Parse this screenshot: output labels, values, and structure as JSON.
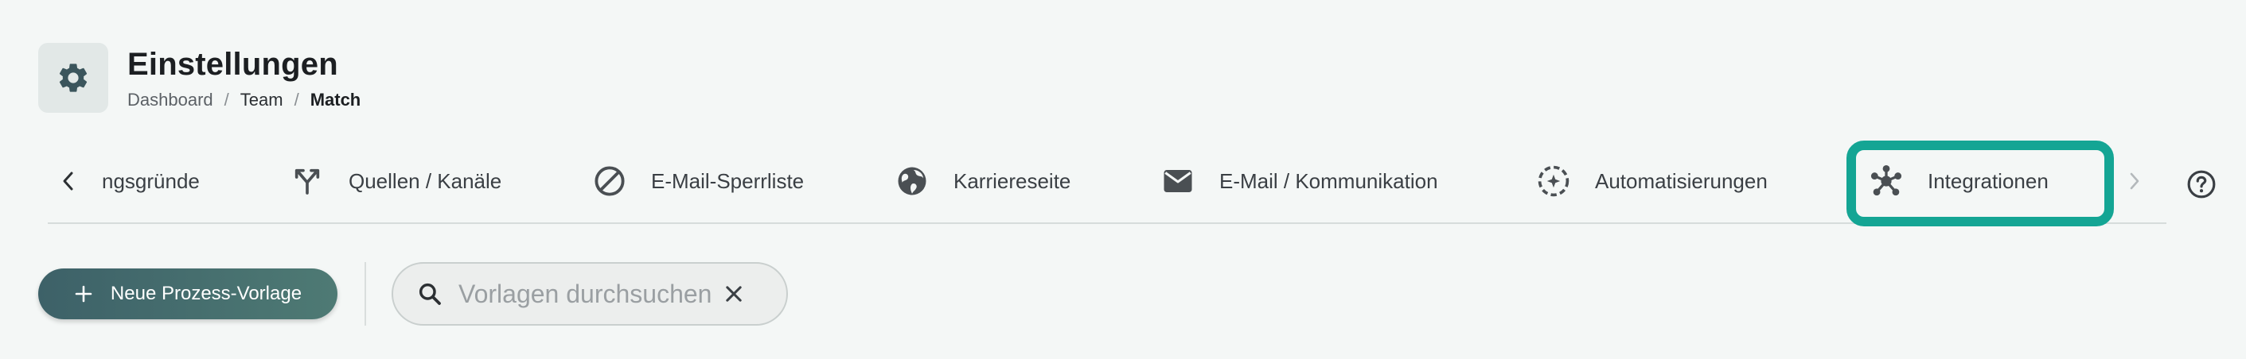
{
  "header": {
    "title": "Einstellungen",
    "icon": "gear-icon",
    "breadcrumb": {
      "items": [
        "Dashboard",
        "Team",
        "Match"
      ],
      "separator": "/"
    }
  },
  "tabs": {
    "scroll_left_icon": "chevron-left-icon",
    "scroll_right_icon": "chevron-right-icon",
    "items": [
      {
        "label": "ngsgründe",
        "icon": null
      },
      {
        "label": "Quellen / Kanäle",
        "icon": "merge-arrows-icon"
      },
      {
        "label": "E-Mail-Sperrliste",
        "icon": "block-icon"
      },
      {
        "label": "Karriereseite",
        "icon": "globe-icon"
      },
      {
        "label": "E-Mail / Kommunikation",
        "icon": "mail-icon"
      },
      {
        "label": "Automatisierungen",
        "icon": "auto-icon"
      },
      {
        "label": "Integrationen",
        "icon": "hub-icon",
        "highlighted": true
      }
    ],
    "highlight_color": "#14a594",
    "help_icon": "help-icon"
  },
  "toolbar": {
    "new_button_label": "Neue Prozess-Vorlage",
    "search": {
      "placeholder": "Vorlagen durchsuchen",
      "value": ""
    }
  },
  "colors": {
    "accent": "#3d6168",
    "background": "#f4f7f6"
  }
}
